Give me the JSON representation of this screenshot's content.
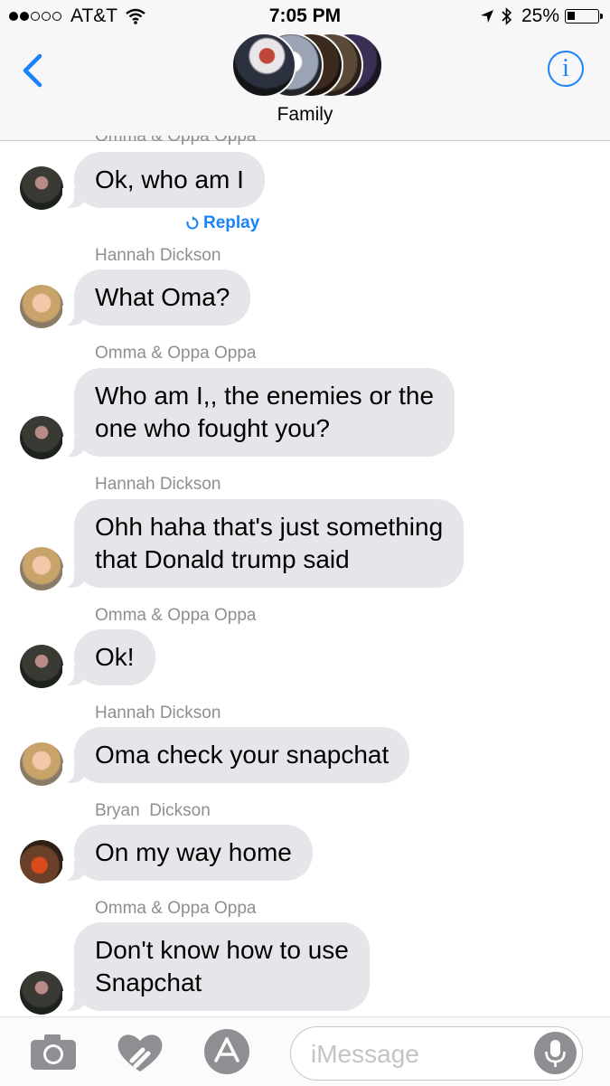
{
  "status_bar": {
    "carrier": "AT&T",
    "time": "7:05 PM",
    "battery": "25%",
    "battery_level": 0.25,
    "signal_bars_filled": 2,
    "signal_bars_total": 5
  },
  "header": {
    "title": "Family",
    "back_icon": "chevron-left-icon",
    "info_label": "i"
  },
  "conversation": {
    "cut_off_sender": "Omma & Oppa Oppa",
    "replay_label": "Replay",
    "messages": [
      {
        "sender": "",
        "avatar": "oma",
        "lines": [
          "Ok, who am I"
        ]
      },
      {
        "sender": "Hannah Dickson",
        "avatar": "hannah",
        "lines": [
          "What Oma?"
        ]
      },
      {
        "sender": "Omma & Oppa Oppa",
        "avatar": "oma",
        "lines": [
          "Who am I,, the enemies or the",
          "one who fought you?"
        ]
      },
      {
        "sender": "Hannah Dickson",
        "avatar": "hannah",
        "lines": [
          "Ohh haha that's just something",
          "that Donald trump said"
        ]
      },
      {
        "sender": "Omma & Oppa Oppa",
        "avatar": "oma",
        "lines": [
          "Ok!"
        ]
      },
      {
        "sender": "Hannah Dickson",
        "avatar": "hannah",
        "lines": [
          "Oma check your snapchat"
        ]
      },
      {
        "sender": "Bryan  Dickson",
        "avatar": "bryan",
        "lines": [
          "On my way home"
        ]
      },
      {
        "sender": "Omma & Oppa Oppa",
        "avatar": "oma",
        "lines": [
          "Don't know how to use",
          "Snapchat"
        ]
      }
    ]
  },
  "input_bar": {
    "placeholder": "iMessage",
    "icons": [
      "camera-icon",
      "digital-touch-heart-icon",
      "app-store-icon",
      "microphone-icon"
    ]
  },
  "colors": {
    "accent": "#1a82fb",
    "bubble_gray": "#e5e5ea",
    "secondary_text": "#8e8e93"
  }
}
